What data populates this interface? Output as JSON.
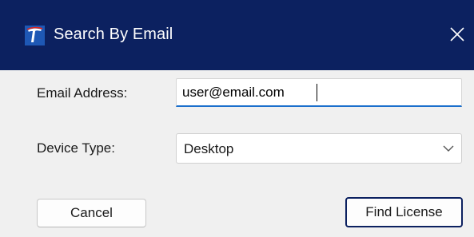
{
  "window": {
    "title": "Search By Email",
    "app_icon": "app-logo-icon",
    "close_icon": "close-icon",
    "colors": {
      "titlebar": "#0c2160",
      "body": "#f0f0f0",
      "accent": "#1b6fcc"
    }
  },
  "form": {
    "email_label": "Email Address:",
    "email_value": "user@email.com",
    "device_label": "Device Type:",
    "device_selected": "Desktop",
    "device_chevron_icon": "chevron-down-icon"
  },
  "buttons": {
    "cancel_label": "Cancel",
    "find_label": "Find License"
  }
}
